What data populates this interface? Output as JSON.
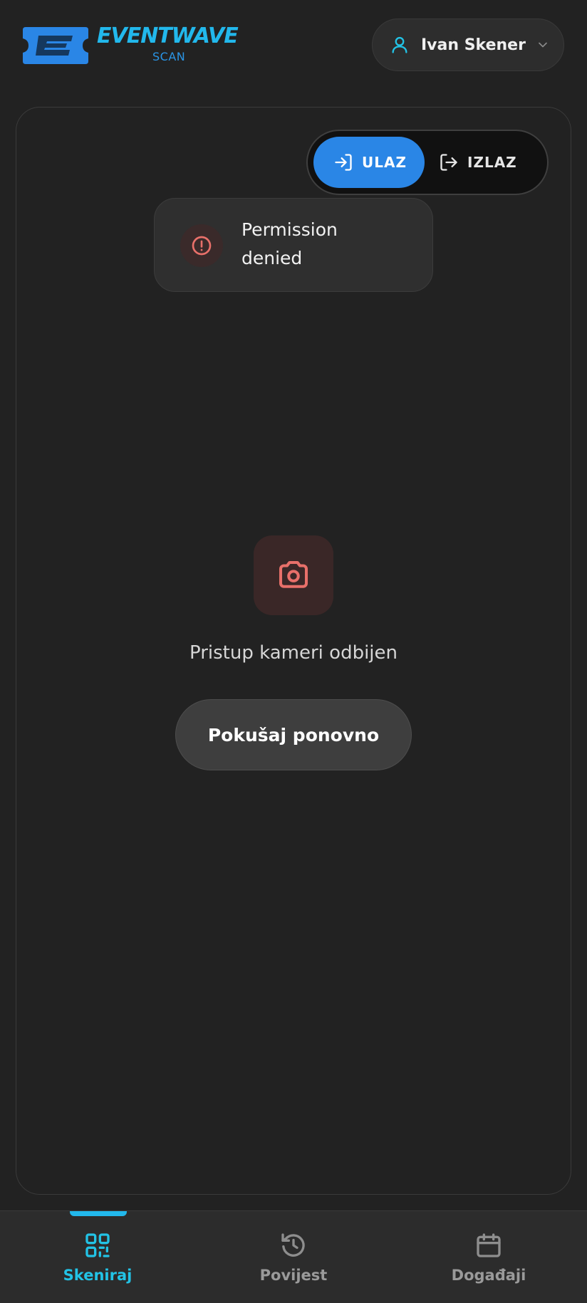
{
  "header": {
    "logo_word": "EVENTWAVE",
    "logo_sub": "SCAN",
    "user_name": "Ivan Skener"
  },
  "mode_toggle": {
    "entry_label": "ULAZ",
    "exit_label": "IZLAZ",
    "selected": "ULAZ"
  },
  "toast": {
    "message_line1": "Permission",
    "message_line2": "denied"
  },
  "camera": {
    "status_text": "Pristup kameri odbijen",
    "retry_label": "Pokušaj ponovno"
  },
  "bottom_nav": {
    "items": [
      {
        "label": "Skeniraj",
        "icon": "qr-code-icon",
        "active": true
      },
      {
        "label": "Povijest",
        "icon": "history-icon",
        "active": false
      },
      {
        "label": "Događaji",
        "icon": "calendar-icon",
        "active": false
      }
    ]
  },
  "colors": {
    "background": "#222222",
    "accent_cyan": "#22b8ec",
    "accent_blue": "#2a86e6",
    "error_red": "#e8706a"
  }
}
